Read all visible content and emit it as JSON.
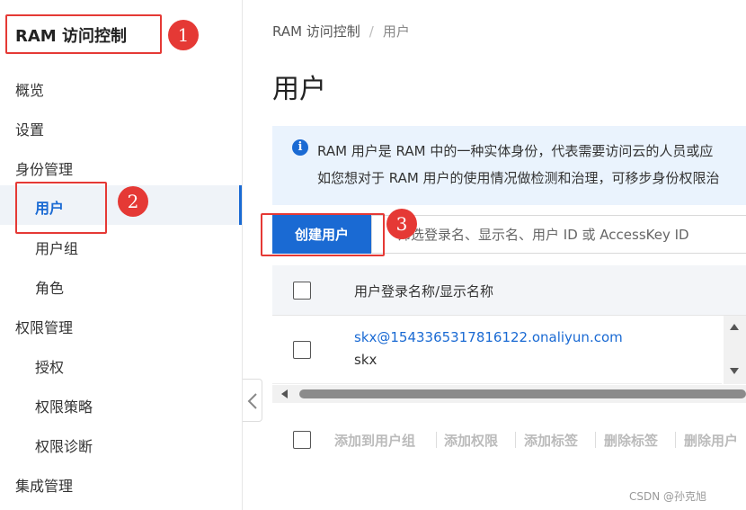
{
  "sidebar": {
    "console_title": "RAM 访问控制",
    "items": [
      {
        "label": "概览"
      },
      {
        "label": "设置"
      },
      {
        "label": "身份管理"
      },
      {
        "label": "用户"
      },
      {
        "label": "用户组"
      },
      {
        "label": "角色"
      },
      {
        "label": "权限管理"
      },
      {
        "label": "授权"
      },
      {
        "label": "权限策略"
      },
      {
        "label": "权限诊断"
      },
      {
        "label": "集成管理"
      }
    ]
  },
  "annotations": {
    "badge1": "1",
    "badge2": "2",
    "badge3": "3"
  },
  "breadcrumb": {
    "root": "RAM 访问控制",
    "separator": "/",
    "current": "用户"
  },
  "page_title": "用户",
  "info_banner": {
    "line1": "RAM 用户是 RAM 中的一种实体身份，代表需要访问云的人员或应",
    "line2": "如您想对于 RAM 用户的使用情况做检测和治理，可移步身份权限治"
  },
  "toolbar": {
    "create_button": "创建用户",
    "search_placeholder": "筛选登录名、显示名、用户 ID 或 AccessKey ID"
  },
  "table": {
    "header": "用户登录名称/显示名称",
    "rows": [
      {
        "login_name": "skx@1543365317816122.onaliyun.com",
        "display_name": "skx"
      }
    ]
  },
  "batch_actions": [
    "添加到用户组",
    "添加权限",
    "添加标签",
    "删除标签",
    "删除用户"
  ],
  "watermark": "CSDN @孙克旭",
  "colors": {
    "accent": "#1a6ad3",
    "annotation": "#e53935",
    "banner_bg": "#eaf3fd"
  }
}
